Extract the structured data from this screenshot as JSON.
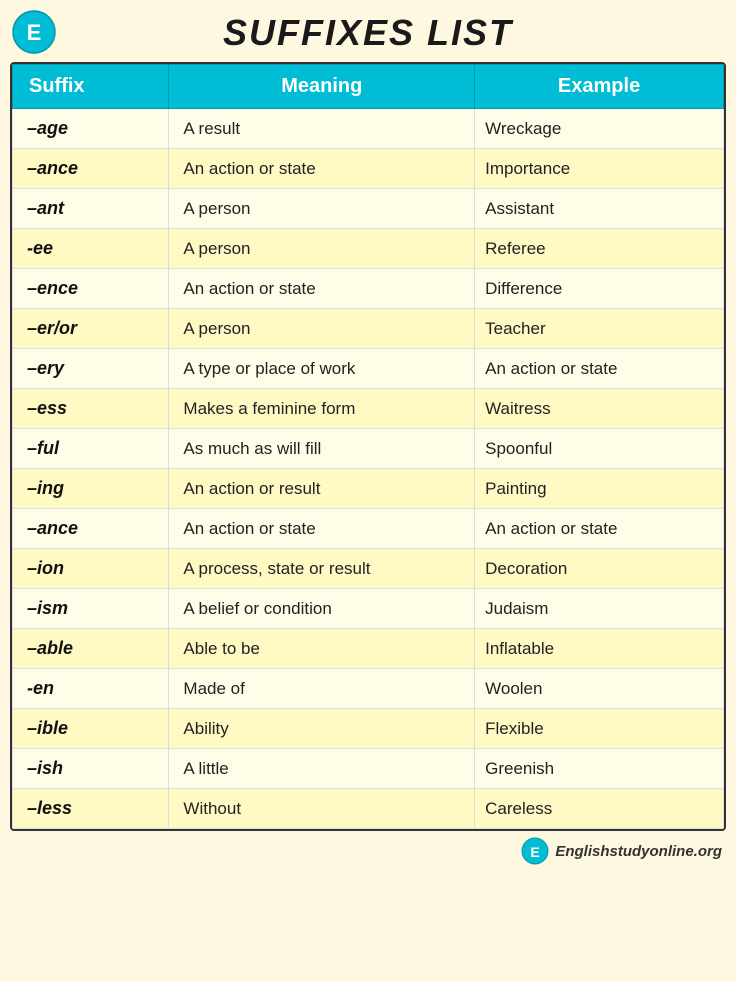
{
  "title": "SUFFIXES LIST",
  "header": {
    "columns": [
      "Suffix",
      "Meaning",
      "Example"
    ]
  },
  "rows": [
    {
      "suffix": "–age",
      "meaning": "A result",
      "example": "Wreckage"
    },
    {
      "suffix": "–ance",
      "meaning": "An action or state",
      "example": "Importance"
    },
    {
      "suffix": "–ant",
      "meaning": "A person",
      "example": "Assistant"
    },
    {
      "suffix": "-ee",
      "meaning": "A person",
      "example": "Referee"
    },
    {
      "suffix": "–ence",
      "meaning": "An action or state",
      "example": "Difference"
    },
    {
      "suffix": "–er/or",
      "meaning": "A person",
      "example": "Teacher"
    },
    {
      "suffix": "–ery",
      "meaning": "A type or place of work",
      "example": "An action or state"
    },
    {
      "suffix": "–ess",
      "meaning": "Makes a feminine form",
      "example": "Waitress"
    },
    {
      "suffix": "–ful",
      "meaning": "As much as will fill",
      "example": "Spoonful"
    },
    {
      "suffix": "–ing",
      "meaning": "An action or result",
      "example": "Painting"
    },
    {
      "suffix": "–ance",
      "meaning": "An action or state",
      "example": "An action or state"
    },
    {
      "suffix": "–ion",
      "meaning": "A process, state or result",
      "example": "Decoration"
    },
    {
      "suffix": "–ism",
      "meaning": "A belief or condition",
      "example": "Judaism"
    },
    {
      "suffix": "–able",
      "meaning": "Able to be",
      "example": "Inflatable"
    },
    {
      "suffix": "-en",
      "meaning": "Made of",
      "example": "Woolen"
    },
    {
      "suffix": "–ible",
      "meaning": "Ability",
      "example": "Flexible"
    },
    {
      "suffix": "–ish",
      "meaning": "A little",
      "example": "Greenish"
    },
    {
      "suffix": "–less",
      "meaning": "Without",
      "example": "Careless"
    }
  ],
  "footer": {
    "site": "Englishstudyonline.org"
  }
}
